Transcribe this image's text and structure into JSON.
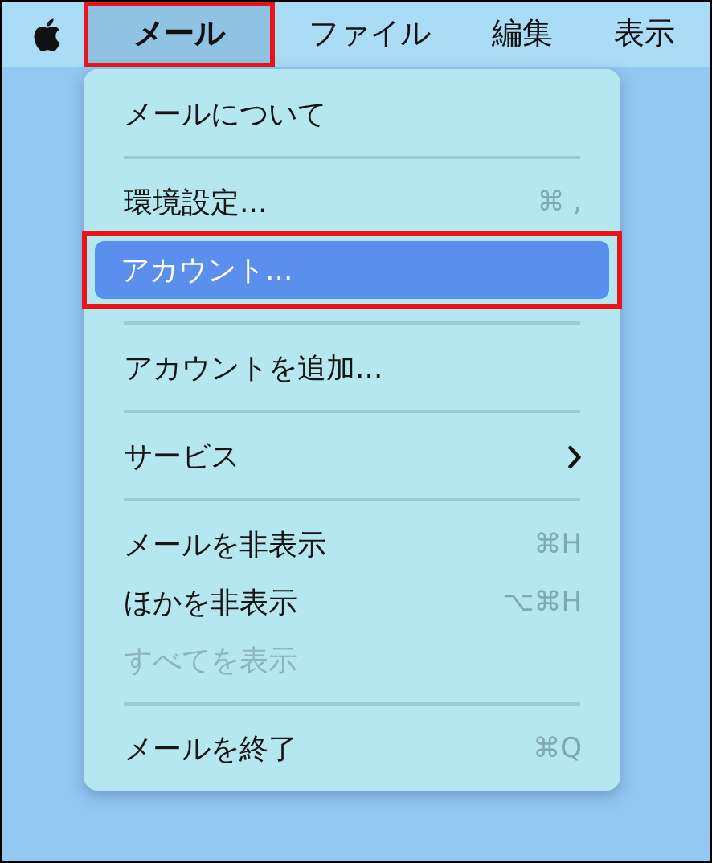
{
  "menu_bar": {
    "items": [
      {
        "kind": "apple"
      },
      {
        "kind": "menu",
        "label": "メール",
        "selected": true,
        "annotated": true
      },
      {
        "kind": "menu",
        "label": "ファイル",
        "selected": false,
        "annotated": false
      },
      {
        "kind": "menu",
        "label": "編集",
        "selected": false,
        "annotated": false
      },
      {
        "kind": "menu",
        "label": "表示",
        "selected": false,
        "annotated": false
      }
    ]
  },
  "menu": {
    "items": [
      {
        "kind": "item",
        "label": "メールについて",
        "selected": false,
        "disabled": false,
        "annotated": false,
        "submenu": false
      },
      {
        "kind": "separator"
      },
      {
        "kind": "item",
        "label": "環境設定...",
        "shortcut": "⌘ ,",
        "selected": false,
        "disabled": false,
        "annotated": false,
        "submenu": false
      },
      {
        "kind": "item",
        "label": "アカウント...",
        "selected": true,
        "disabled": false,
        "annotated": true,
        "submenu": false
      },
      {
        "kind": "separator"
      },
      {
        "kind": "item",
        "label": "アカウントを追加...",
        "selected": false,
        "disabled": false,
        "annotated": false,
        "submenu": false
      },
      {
        "kind": "separator"
      },
      {
        "kind": "item",
        "label": "サービス",
        "selected": false,
        "disabled": false,
        "annotated": false,
        "submenu": true
      },
      {
        "kind": "separator"
      },
      {
        "kind": "item",
        "label": "メールを非表示",
        "shortcut": "⌘H",
        "selected": false,
        "disabled": false,
        "annotated": false,
        "submenu": false
      },
      {
        "kind": "item",
        "label": "ほかを非表示",
        "shortcut": "⌥⌘H",
        "selected": false,
        "disabled": false,
        "annotated": false,
        "submenu": false
      },
      {
        "kind": "item",
        "label": "すべてを表示",
        "selected": false,
        "disabled": true,
        "annotated": false,
        "submenu": false
      },
      {
        "kind": "separator"
      },
      {
        "kind": "item",
        "label": "メールを終了",
        "shortcut": "⌘Q",
        "selected": false,
        "disabled": false,
        "annotated": false,
        "submenu": false
      }
    ]
  }
}
